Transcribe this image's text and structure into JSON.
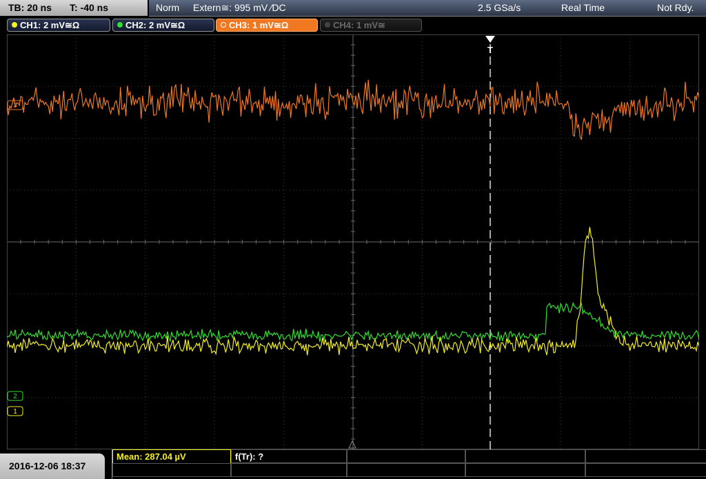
{
  "timebase": {
    "tb": "TB: 20 ns",
    "t": "T: -40 ns"
  },
  "trigger": {
    "mode": "Norm",
    "source": "Extern≅: 995 mV ∕DC"
  },
  "acquisition": {
    "sample_rate": "2.5 GSa/s",
    "mode": "Real Time",
    "state": "Not Rdy."
  },
  "channels": [
    {
      "label": "CH1: 2 mV≅Ω",
      "color": "#f5f020",
      "state": "on"
    },
    {
      "label": "CH2: 2 mV≅Ω",
      "color": "#30e030",
      "state": "on"
    },
    {
      "label": "CH3: 1 mV≅Ω",
      "color": "#f07820",
      "state": "active"
    },
    {
      "label": "CH4: 1 mV≅",
      "color": "#5a5a5a",
      "state": "off"
    }
  ],
  "trigger_marker": "T",
  "channel_markers": {
    "ch3": "3",
    "ch1": "1",
    "ch2": "2"
  },
  "measurements": {
    "mean": "Mean: 287.04 µV",
    "ftr": "f(Tr): ?"
  },
  "datetime": "2016-12-06 18:37",
  "colors": {
    "ch1": "#f5f020",
    "ch2": "#30e030",
    "ch3": "#f07820",
    "grid": "#3a3a3a",
    "grid_axis": "#6a6a6a"
  },
  "chart_data": {
    "type": "line",
    "title": "",
    "grid": {
      "h_divisions": 10,
      "v_divisions": 8
    },
    "series": [
      {
        "name": "CH3",
        "baseline_div": 1.3,
        "noise_div": 0.45,
        "features": [
          {
            "at_div": 8.1,
            "shape": "dip",
            "depth_div": 0.95
          }
        ]
      },
      {
        "name": "CH2",
        "baseline_div": 5.8,
        "noise_div": 0.15,
        "features": [
          {
            "at_div": 7.8,
            "shape": "step",
            "height_div": 0.55,
            "until_div": 8.3
          }
        ]
      },
      {
        "name": "CH1",
        "baseline_div": 6.0,
        "noise_div": 0.22,
        "features": [
          {
            "at_div": 8.3,
            "shape": "pulse",
            "height_div": 2.0
          }
        ]
      }
    ]
  }
}
